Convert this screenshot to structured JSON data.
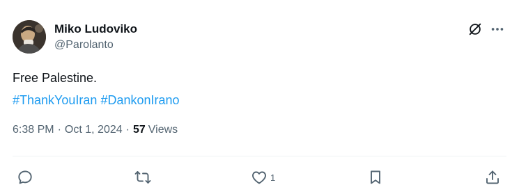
{
  "author": {
    "display_name": "Miko Ludoviko",
    "handle": "@Parolanto"
  },
  "tweet": {
    "text": "Free Palestine.",
    "hashtags": [
      "#ThankYouIran",
      "#DankonIrano"
    ]
  },
  "meta": {
    "time": "6:38 PM",
    "separator": "·",
    "date": "Oct 1, 2024",
    "views_count": "57",
    "views_label": "Views"
  },
  "actions": {
    "reply_count": "",
    "retweet_count": "",
    "like_count": "1",
    "bookmark_count": "",
    "share_count": ""
  },
  "icons": {
    "grok": "grok-icon",
    "more": "more-icon",
    "reply": "reply-icon",
    "retweet": "retweet-icon",
    "like": "heart-icon",
    "bookmark": "bookmark-icon",
    "share": "share-icon"
  },
  "colors": {
    "text": "#0f1419",
    "secondary": "#536471",
    "link": "#1d9bf0",
    "divider": "#eff3f4"
  }
}
